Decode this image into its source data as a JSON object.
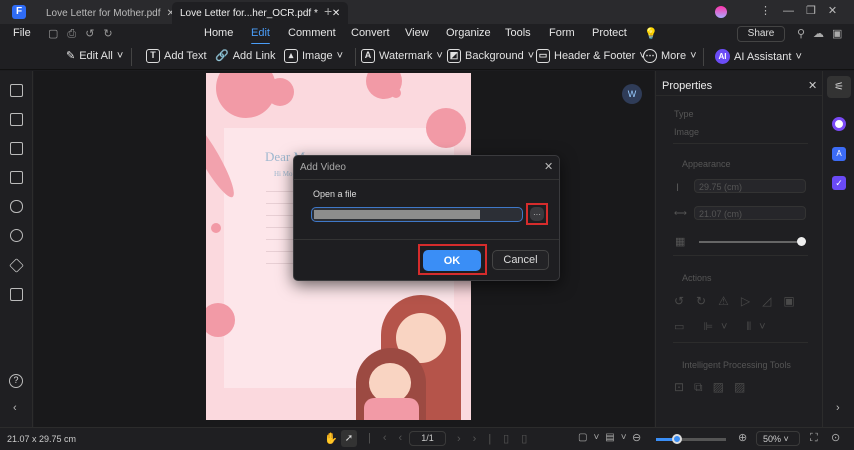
{
  "tabs": [
    {
      "label": "Love Letter for Mother.pdf"
    },
    {
      "label": "Love Letter for...her_OCR.pdf *"
    }
  ],
  "menu": {
    "file": "File",
    "items": [
      "Home",
      "Edit",
      "Comment",
      "Convert",
      "View",
      "Organize",
      "Tools",
      "Form",
      "Protect"
    ],
    "active": "Edit",
    "share": "Share"
  },
  "toolbar": {
    "edit_all": "Edit All",
    "add_text": "Add Text",
    "add_link": "Add Link",
    "image": "Image",
    "watermark": "Watermark",
    "background": "Background",
    "header_footer": "Header & Footer",
    "more": "More",
    "ai_assistant": "AI Assistant",
    "ai_badge": "AI"
  },
  "page": {
    "greeting": "Dear M",
    "line": "Hi Mo"
  },
  "properties": {
    "title": "Properties",
    "type_label": "Type",
    "type_value": "Image",
    "appearance": "Appearance",
    "height": "29.75 (cm)",
    "width": "21.07 (cm)",
    "opacity": 1.0,
    "actions": "Actions",
    "intelligent": "Intelligent Processing Tools"
  },
  "dialog": {
    "title": "Add Video",
    "open_label": "Open a file",
    "file_path": "",
    "browse": "···",
    "ok": "OK",
    "cancel": "Cancel"
  },
  "status": {
    "dimensions": "21.07 x 29.75 cm",
    "page": "1/1",
    "zoom": "50%",
    "zoom_slider": 0.15
  },
  "colors": {
    "accent": "#4a9df8",
    "highlight": "#d62c2c"
  }
}
